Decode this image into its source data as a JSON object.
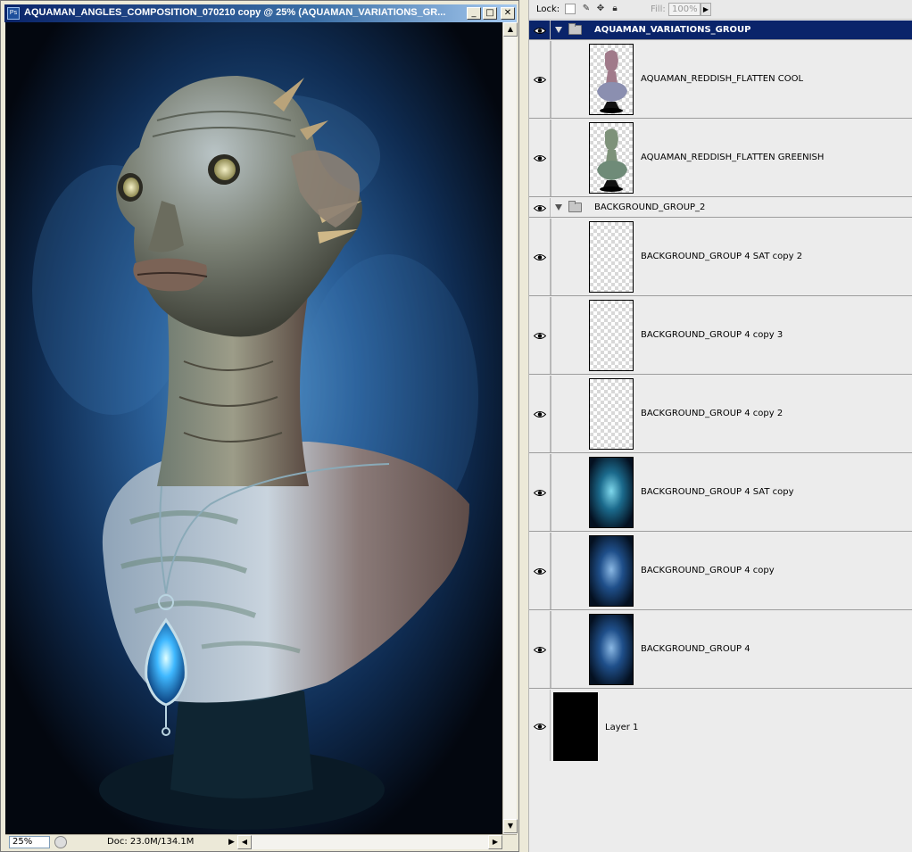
{
  "document": {
    "app_icon_text": "Ps",
    "title": "AQUAMAN_ANGLES_COMPOSITION_070210 copy @ 25% (AQUAMAN_VARIATIONS_GR...",
    "minimize": "_",
    "maximize": "□",
    "close": "✕",
    "zoom": "25%",
    "doc_size": "Doc: 23.0M/134.1M"
  },
  "layers_panel": {
    "lock_label": "Lock:",
    "fill_label": "Fill:",
    "fill_value": "100%",
    "layers": [
      {
        "kind": "group",
        "name": "AQUAMAN_VARIATIONS_GROUP",
        "selected": true
      },
      {
        "kind": "layer",
        "name": "AQUAMAN_REDDISH_FLATTEN COOL",
        "thumb": "bust-cool",
        "indented": true
      },
      {
        "kind": "layer",
        "name": "AQUAMAN_REDDISH_FLATTEN GREENISH",
        "thumb": "bust-green",
        "indented": true
      },
      {
        "kind": "group",
        "name": "BACKGROUND_GROUP_2",
        "selected": false
      },
      {
        "kind": "layer",
        "name": "BACKGROUND_GROUP 4 SAT copy 2",
        "thumb": "transparent",
        "indented": true
      },
      {
        "kind": "layer",
        "name": "BACKGROUND_GROUP 4 copy 3",
        "thumb": "transparent",
        "indented": true
      },
      {
        "kind": "layer",
        "name": "BACKGROUND_GROUP 4 copy 2",
        "thumb": "transparent",
        "indented": true
      },
      {
        "kind": "layer",
        "name": "BACKGROUND_GROUP 4 SAT copy",
        "thumb": "nebula-teal",
        "indented": true
      },
      {
        "kind": "layer",
        "name": "BACKGROUND_GROUP 4 copy",
        "thumb": "nebula-blue",
        "indented": true
      },
      {
        "kind": "layer",
        "name": "BACKGROUND_GROUP 4",
        "thumb": "nebula-blue",
        "indented": true
      },
      {
        "kind": "layer",
        "name": "Layer 1",
        "thumb": "black",
        "indented": false
      }
    ]
  },
  "colors": {
    "title_gradient_start": "#0a246a",
    "selected_layer": "#0a246a",
    "canvas_background": "#060a12"
  }
}
